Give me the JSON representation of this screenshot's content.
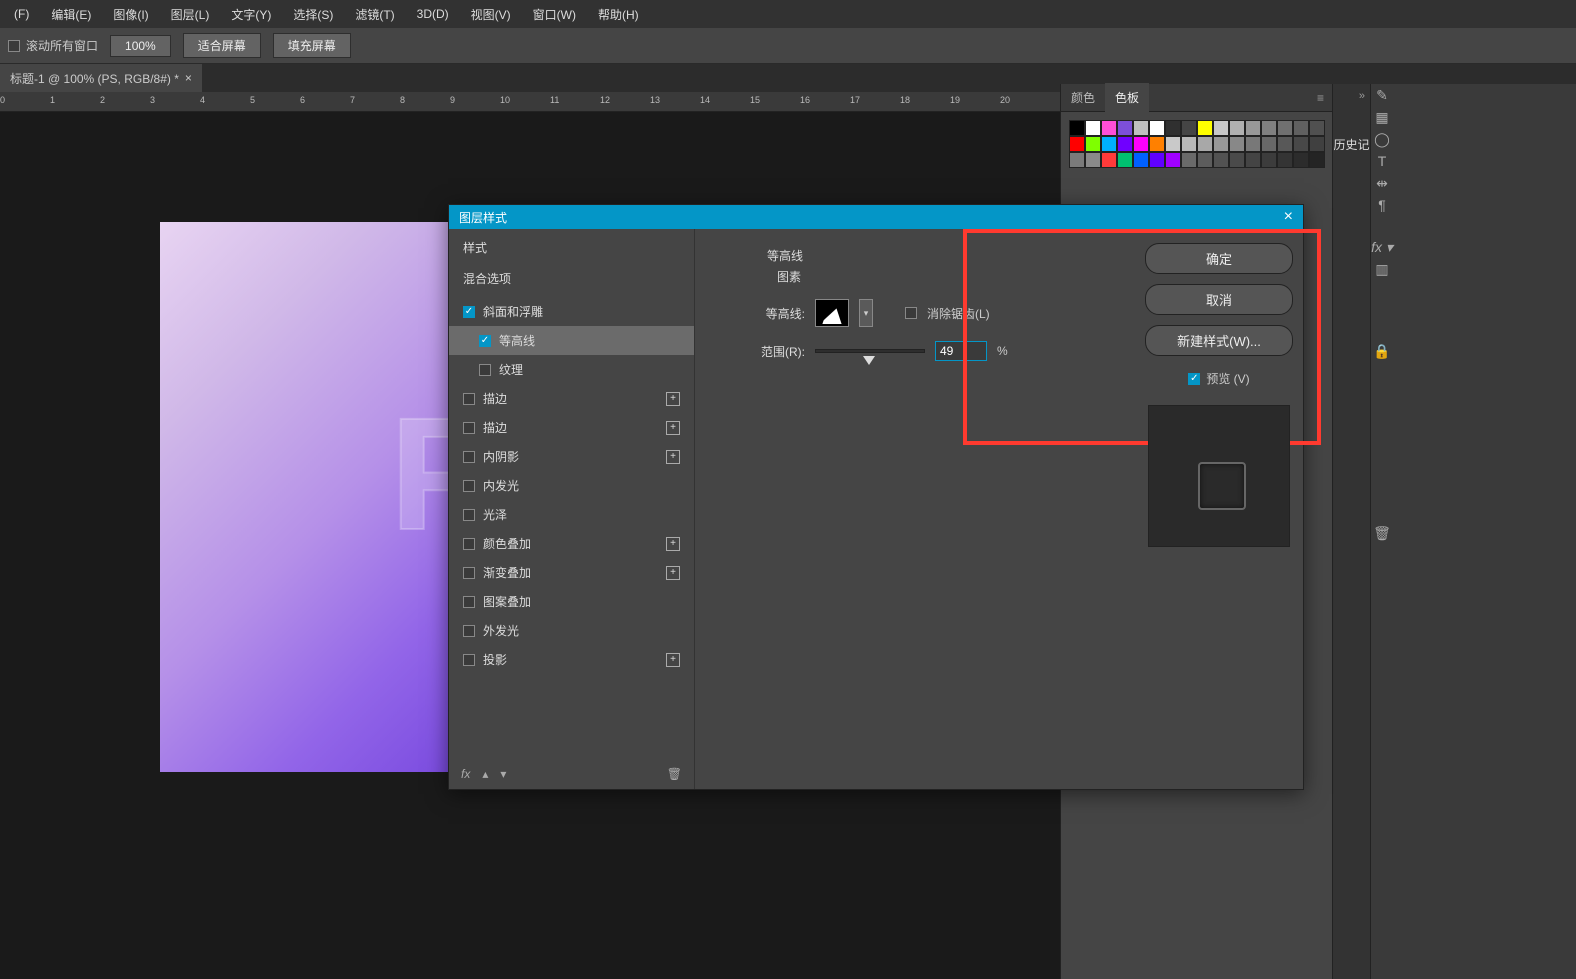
{
  "menu": [
    "(F)",
    "编辑(E)",
    "图像(I)",
    "图层(L)",
    "文字(Y)",
    "选择(S)",
    "滤镜(T)",
    "3D(D)",
    "视图(V)",
    "窗口(W)",
    "帮助(H)"
  ],
  "options": {
    "scroll_all_label": "滚动所有窗口",
    "zoom": "100%",
    "fit_screen": "适合屏幕",
    "fill_screen": "填充屏幕"
  },
  "tab": {
    "title": "标题-1 @ 100% (PS, RGB/8#) *"
  },
  "ruler_ticks": [
    "0",
    "1",
    "2",
    "3",
    "4",
    "5",
    "6",
    "7",
    "8",
    "9",
    "10",
    "11",
    "12",
    "13",
    "14",
    "15",
    "16",
    "17",
    "18",
    "19",
    "20"
  ],
  "color_tabs": {
    "color": "颜色",
    "swatch": "色板"
  },
  "right_side_tab": "历史记",
  "swatches_row1": [
    "#000000",
    "#ffffff",
    "#ff4fd8",
    "#7d4fd8",
    "#c0c0c0",
    "#ffffff",
    "#303030",
    "",
    "#ffff00",
    "#c8c8c8",
    "#b0b0b0",
    "#989898",
    "#808080",
    "#707070",
    "#606060",
    "#505050"
  ],
  "swatches_row2": [
    "#ff0000",
    "#7fff00",
    "#00b0ff",
    "#7000ff",
    "#ff00ff",
    "#ff8000",
    "#c9c9c9",
    "#b8b8b8",
    "#a8a8a8",
    "#989898",
    "#888888",
    "#787878",
    "#686868",
    "#585858",
    "#484848",
    "#404040"
  ],
  "swatches_row3": [
    "#7a7a7a",
    "#8a8a8a",
    "#ff3a3a",
    "#00c070",
    "#0060ff",
    "#6000ff",
    "#a000ff",
    "#6a6a6a",
    "#5c5c5c",
    "#525252",
    "#4a4a4a",
    "#444444",
    "#3c3c3c",
    "#343434",
    "#2c2c2c",
    "#242424"
  ],
  "dialog": {
    "title": "图层样式",
    "list": {
      "styles": "样式",
      "blend": "混合选项",
      "bevel": "斜面和浮雕",
      "contour": "等高线",
      "texture": "纹理",
      "stroke1": "描边",
      "stroke2": "描边",
      "inner_shadow": "内阴影",
      "inner_glow": "内发光",
      "satin": "光泽",
      "color_overlay": "颜色叠加",
      "grad_overlay": "渐变叠加",
      "pattern_overlay": "图案叠加",
      "outer_glow": "外发光",
      "drop_shadow": "投影",
      "fx_label": "fx"
    },
    "content": {
      "header_top": "等高线",
      "header": "图素",
      "contour_label": "等高线:",
      "anti_alias": "消除锯齿(L)",
      "range_label": "范围(R):",
      "range_value": "49",
      "range_unit": "%"
    },
    "actions": {
      "ok": "确定",
      "cancel": "取消",
      "new_style": "新建样式(W)...",
      "preview": "预览 (V)"
    }
  }
}
